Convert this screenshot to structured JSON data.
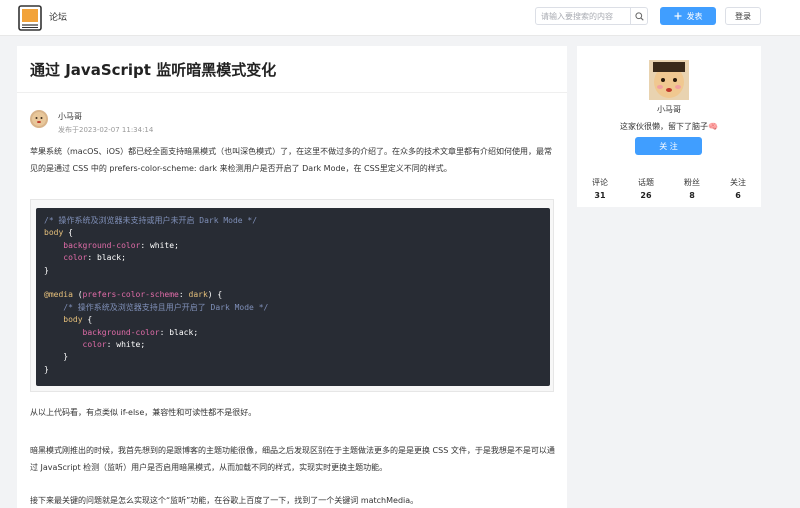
{
  "header": {
    "brand": "论坛",
    "search_placeholder": "请输入要搜索的内容",
    "post_label": "发表",
    "login_label": "登录"
  },
  "article": {
    "title": "通过 JavaScript 监听暗黑模式变化",
    "author": "小马哥",
    "published": "发布于2023-02-07 11:34:14",
    "paragraphs": [
      "苹果系统（macOS、iOS）都已经全面支持暗黑模式（也叫深色模式）了，在这里不做过多的介绍了。在众多的技术文章里都有介绍如何使用，最常见的是通过 CSS 中的 prefers-color-scheme: dark 来检测用户是否开启了 Dark Mode，在 CSS里定义不同的样式。",
      "从以上代码看，有点类似 if-else，兼容性和可读性都不是很好。",
      "暗黑模式刚推出的时候，我首先想到的是跟博客的主题功能很像，细品之后发现区别在于主题做法更多的是是更换 CSS 文件，于是我想是不是可以通过 JavaScript 检测（监听）用户是否启用暗黑模式，从而加载不同的样式，实现实时更换主题功能。",
      "接下来最关键的问题就是怎么实现这个“监听”功能，在谷歌上百度了一下，找到了一个关键词 matchMedia。"
    ],
    "code": {
      "comment1": "/* 操作系统及浏览器未支持或用户未开启 Dark Mode */",
      "selector1": "body",
      "prop_bg": "background-color",
      "val_white": "white",
      "prop_color": "color",
      "val_black": "black",
      "media": "@media",
      "media_feature": "prefers-color-scheme",
      "media_value": "dark",
      "comment2": "/* 操作系统及浏览器支持且用户开启了 Dark Mode */"
    }
  },
  "profile": {
    "name": "小马哥",
    "bio": "这家伙很懒，留下了脑子🧠",
    "follow_label": "关 注",
    "stats": [
      {
        "label": "评论",
        "value": "31"
      },
      {
        "label": "话题",
        "value": "26"
      },
      {
        "label": "粉丝",
        "value": "8"
      },
      {
        "label": "关注",
        "value": "6"
      }
    ]
  },
  "colors": {
    "primary": "#409eff",
    "background": "#f2f3f5",
    "code_bg": "#282c34"
  },
  "icons": {
    "logo": "book-logo-icon",
    "search": "search-icon",
    "plus": "plus-icon"
  }
}
